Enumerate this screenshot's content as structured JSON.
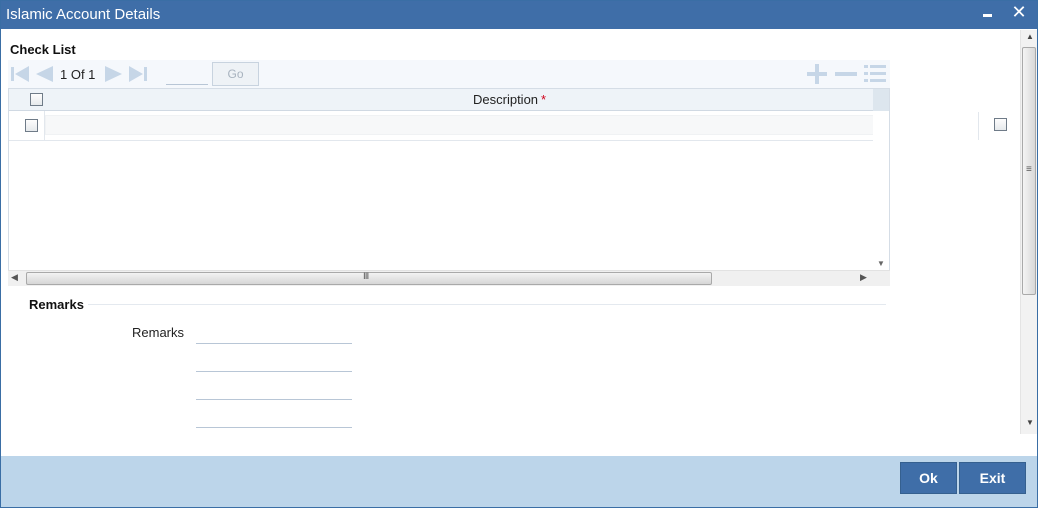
{
  "window": {
    "title": "Islamic Account Details",
    "minimize_icon": "minimize-icon",
    "close_icon": "close-icon",
    "close_glyph": "✕"
  },
  "checklist": {
    "section_title": "Check List",
    "pager": {
      "current_page": 1,
      "total_pages": 1,
      "text": "1 Of 1",
      "page_input_value": "",
      "go_label": "Go",
      "icons": [
        "first-page-icon",
        "previous-page-icon",
        "next-page-icon",
        "last-page-icon"
      ]
    },
    "tools": [
      "add-row-icon",
      "delete-row-icon",
      "single-view-icon"
    ],
    "columns": [
      {
        "label": "Description",
        "required_marker": "*"
      }
    ],
    "rows": [
      {
        "description": "",
        "checked": false
      }
    ]
  },
  "remarks": {
    "section_title": "Remarks",
    "field_label": "Remarks",
    "lines": [
      "",
      "",
      "",
      ""
    ]
  },
  "footer": {
    "ok_label": "Ok",
    "exit_label": "Exit"
  },
  "colors": {
    "titlebar": "#3f6ea8",
    "footer": "#bcd5ea",
    "button": "#3f6ea8",
    "required": "#d0021b",
    "nav_icon": "#c6d6e7"
  }
}
